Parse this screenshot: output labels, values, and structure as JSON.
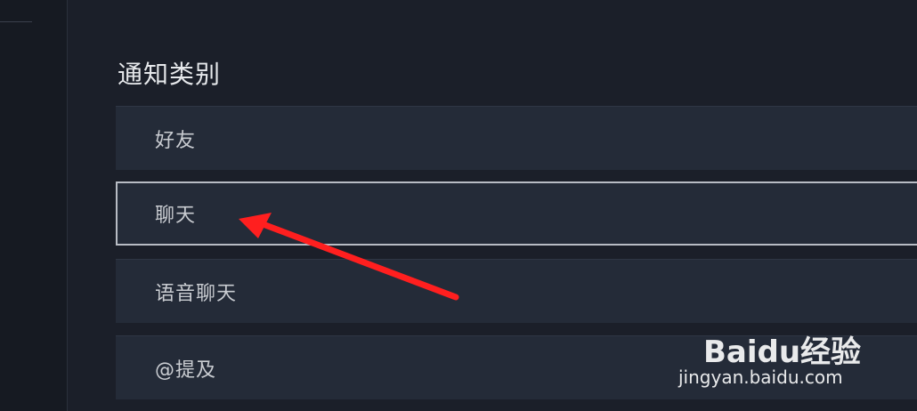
{
  "section_title": "通知类别",
  "categories": [
    {
      "label": "好友",
      "selected": false
    },
    {
      "label": "聊天",
      "selected": true
    },
    {
      "label": "语音聊天",
      "selected": false
    },
    {
      "label": "@提及",
      "selected": false
    }
  ],
  "annotation": {
    "type": "red-arrow",
    "color": "#ff1f1f"
  },
  "watermark": {
    "logo": "Baidu经验",
    "url": "jingyan.baidu.com"
  }
}
